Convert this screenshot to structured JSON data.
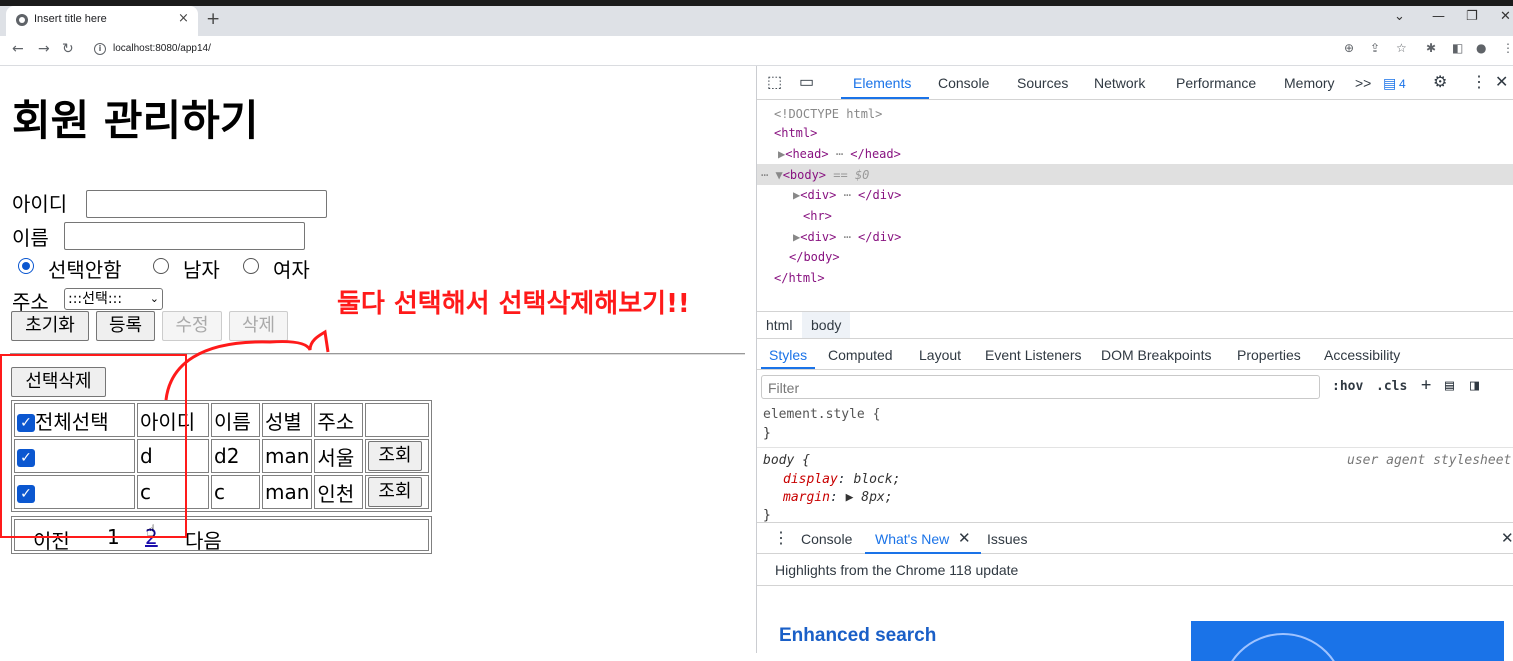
{
  "browser": {
    "tab_title": "Insert title here",
    "tab_close": "×",
    "new_tab": "+",
    "url": "localhost:8080/app14/"
  },
  "page": {
    "heading": "회원 관리하기",
    "id_label": "아이디",
    "name_label": "이름",
    "gender_options": [
      "선택안함",
      "남자",
      "여자"
    ],
    "gender_selected": "선택안함",
    "address_label": "주소",
    "address_select_value": ":::선택:::",
    "buttons": {
      "reset": "초기화",
      "register": "등록",
      "edit": "수정",
      "delete": "삭제"
    },
    "delete_selected": "선택삭제",
    "table": {
      "headers": [
        "전체선택",
        "아이디",
        "이름",
        "성별",
        "주소"
      ],
      "rows": [
        {
          "id": "d",
          "name": "d2",
          "gender": "man",
          "address": "서울",
          "action": "조회"
        },
        {
          "id": "c",
          "name": "c",
          "gender": "man",
          "address": "인천",
          "action": "조회"
        }
      ]
    },
    "pager": {
      "prev": "이전",
      "page1": "1",
      "page2": "2",
      "next": "다음"
    },
    "annotation": "둘다 선택해서 선택삭제해보기!!"
  },
  "devtools": {
    "tabs": [
      "Elements",
      "Console",
      "Sources",
      "Network",
      "Performance",
      "Memory"
    ],
    "active_tab": "Elements",
    "more": ">>",
    "issues_count": "4",
    "dom": {
      "doctype": "<!DOCTYPE html>",
      "html_open": "<html>",
      "head": "<head>",
      "head_close": "</head>",
      "body": "<body>",
      "body_eq": "== $0",
      "div": "<div>",
      "div_close": "</div>",
      "hr": "<hr>",
      "body_close": "</body>",
      "html_close": "</html>"
    },
    "breadcrumbs": [
      "html",
      "body"
    ],
    "subtabs": [
      "Styles",
      "Computed",
      "Layout",
      "Event Listeners",
      "DOM Breakpoints",
      "Properties",
      "Accessibility"
    ],
    "filter_placeholder": "Filter",
    "hov": ":hov",
    "cls": ".cls",
    "styles": {
      "element_style": "element.style {",
      "close_brace": "}",
      "body_rule": "body {",
      "user_agent": "user agent stylesheet",
      "prop1_name": "display",
      "prop1_value": "block;",
      "prop2_name": "margin",
      "prop2_value": "▶ 8px;"
    },
    "drawer_tabs": [
      "Console",
      "What's New",
      "Issues"
    ],
    "drawer_active": "What's New",
    "highlights": "Highlights from the Chrome 118 update",
    "enhanced": "Enhanced search"
  }
}
